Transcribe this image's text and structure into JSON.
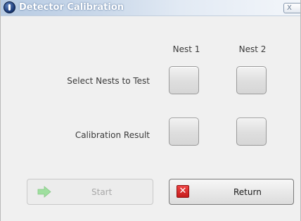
{
  "window": {
    "title": "Detector Calibration",
    "close_label": "X"
  },
  "columns": [
    "Nest 1",
    "Nest 2"
  ],
  "rows": {
    "select_label": "Select Nests to Test",
    "result_label": "Calibration Result"
  },
  "buttons": {
    "start_label": "Start",
    "start_enabled": false,
    "return_label": "Return",
    "return_icon_glyph": "✕"
  },
  "colors": {
    "start_arrow": "#9fdf9f",
    "return_icon": "#d92b2b",
    "title_bar_start": "#b7cbe3"
  }
}
